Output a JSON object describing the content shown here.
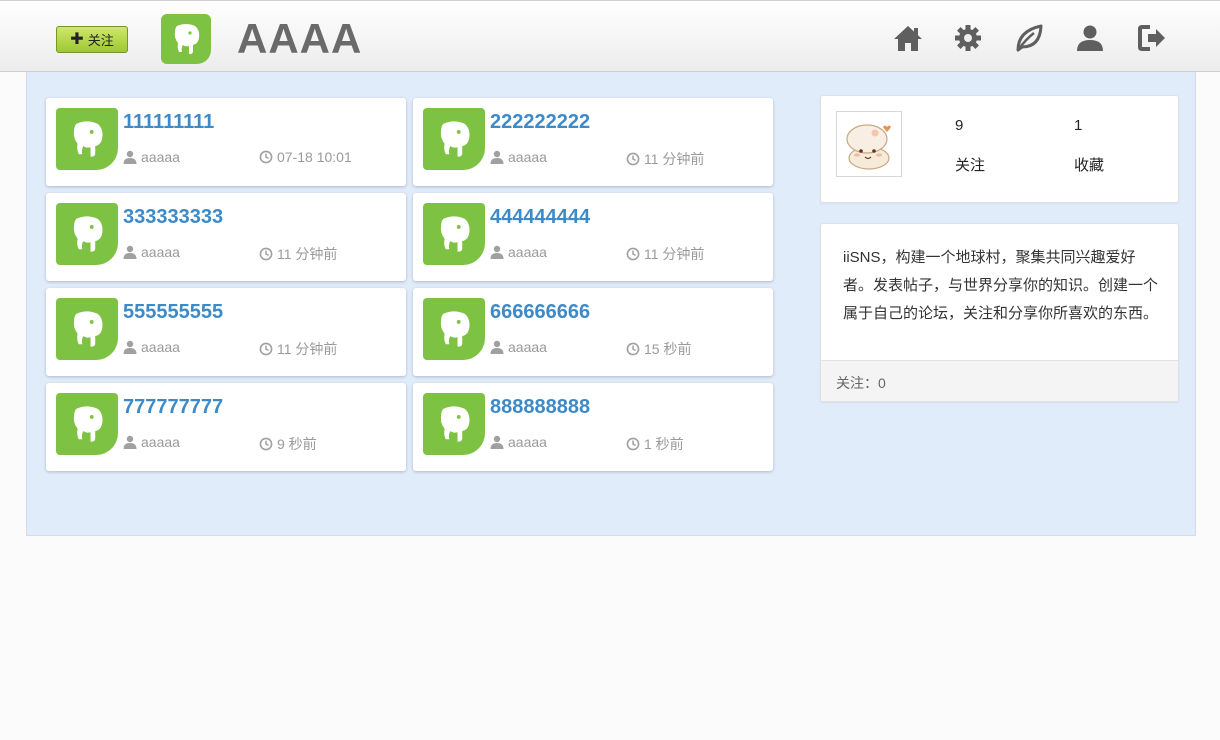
{
  "header": {
    "follow_button_label": "关注",
    "site_title": "AAAA",
    "nav": [
      {
        "icon": "home-icon"
      },
      {
        "icon": "gear-icon"
      },
      {
        "icon": "leaf-icon"
      },
      {
        "icon": "user-icon"
      },
      {
        "icon": "logout-icon"
      }
    ]
  },
  "posts": [
    {
      "title": "111111111",
      "author": "aaaaa",
      "time": "07-18 10:01"
    },
    {
      "title": "222222222",
      "author": "aaaaa",
      "time": "11 分钟前"
    },
    {
      "title": "333333333",
      "author": "aaaaa",
      "time": "11 分钟前"
    },
    {
      "title": "444444444",
      "author": "aaaaa",
      "time": "11 分钟前"
    },
    {
      "title": "555555555",
      "author": "aaaaa",
      "time": "11 分钟前"
    },
    {
      "title": "666666666",
      "author": "aaaaa",
      "time": "15 秒前"
    },
    {
      "title": "777777777",
      "author": "aaaaa",
      "time": "9 秒前"
    },
    {
      "title": "888888888",
      "author": "aaaaa",
      "time": "1 秒前"
    }
  ],
  "profile": {
    "following_count": "9",
    "following_label": "关注",
    "favorites_count": "1",
    "favorites_label": "收藏"
  },
  "about": {
    "line1": "iiSNS，构建一个地球村，聚集共同兴趣爱好",
    "line2": "者。发表帖子，与世界分享你的知识。创建一个",
    "line3": "属于自己的论坛，关注和分享你所喜欢的东西。",
    "footer": "关注：0"
  },
  "colors": {
    "accent_green": "#7dc242",
    "link_blue": "#3d8ac8",
    "content_bg": "#e1ecfb"
  }
}
